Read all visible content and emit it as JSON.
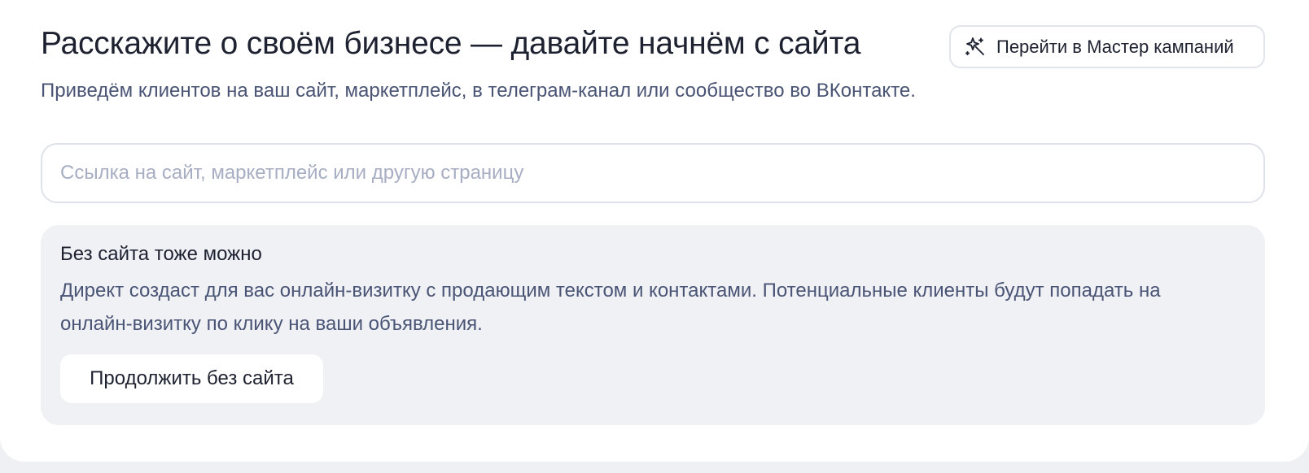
{
  "header": {
    "title": "Расскажите о своём бизнесе — давайте начнём с сайта",
    "subtitle": "Приведём клиентов на ваш сайт, маркетплейс, в телеграм-канал или сообщество во ВКонтакте.",
    "master_button": {
      "label": "Перейти в Мастер кампаний",
      "icon": "magic-wand-icon"
    }
  },
  "url_input": {
    "value": "",
    "placeholder": "Ссылка на сайт, маркетплейс или другую страницу"
  },
  "no_site_panel": {
    "title": "Без сайта тоже можно",
    "text": "Директ создаст для вас онлайн-визитку с продающим текстом и контактами. Потенциальные клиенты будут попадать на онлайн-визитку по клику на ваши объявления.",
    "continue_label": "Продолжить без сайта"
  },
  "colors": {
    "page_background": "#eef0f4",
    "card_background": "#ffffff",
    "panel_background": "#eff1f5",
    "text_primary": "#1d2130",
    "text_secondary": "#4a5475",
    "placeholder": "#a7aec3",
    "border": "#dfe2ea"
  }
}
